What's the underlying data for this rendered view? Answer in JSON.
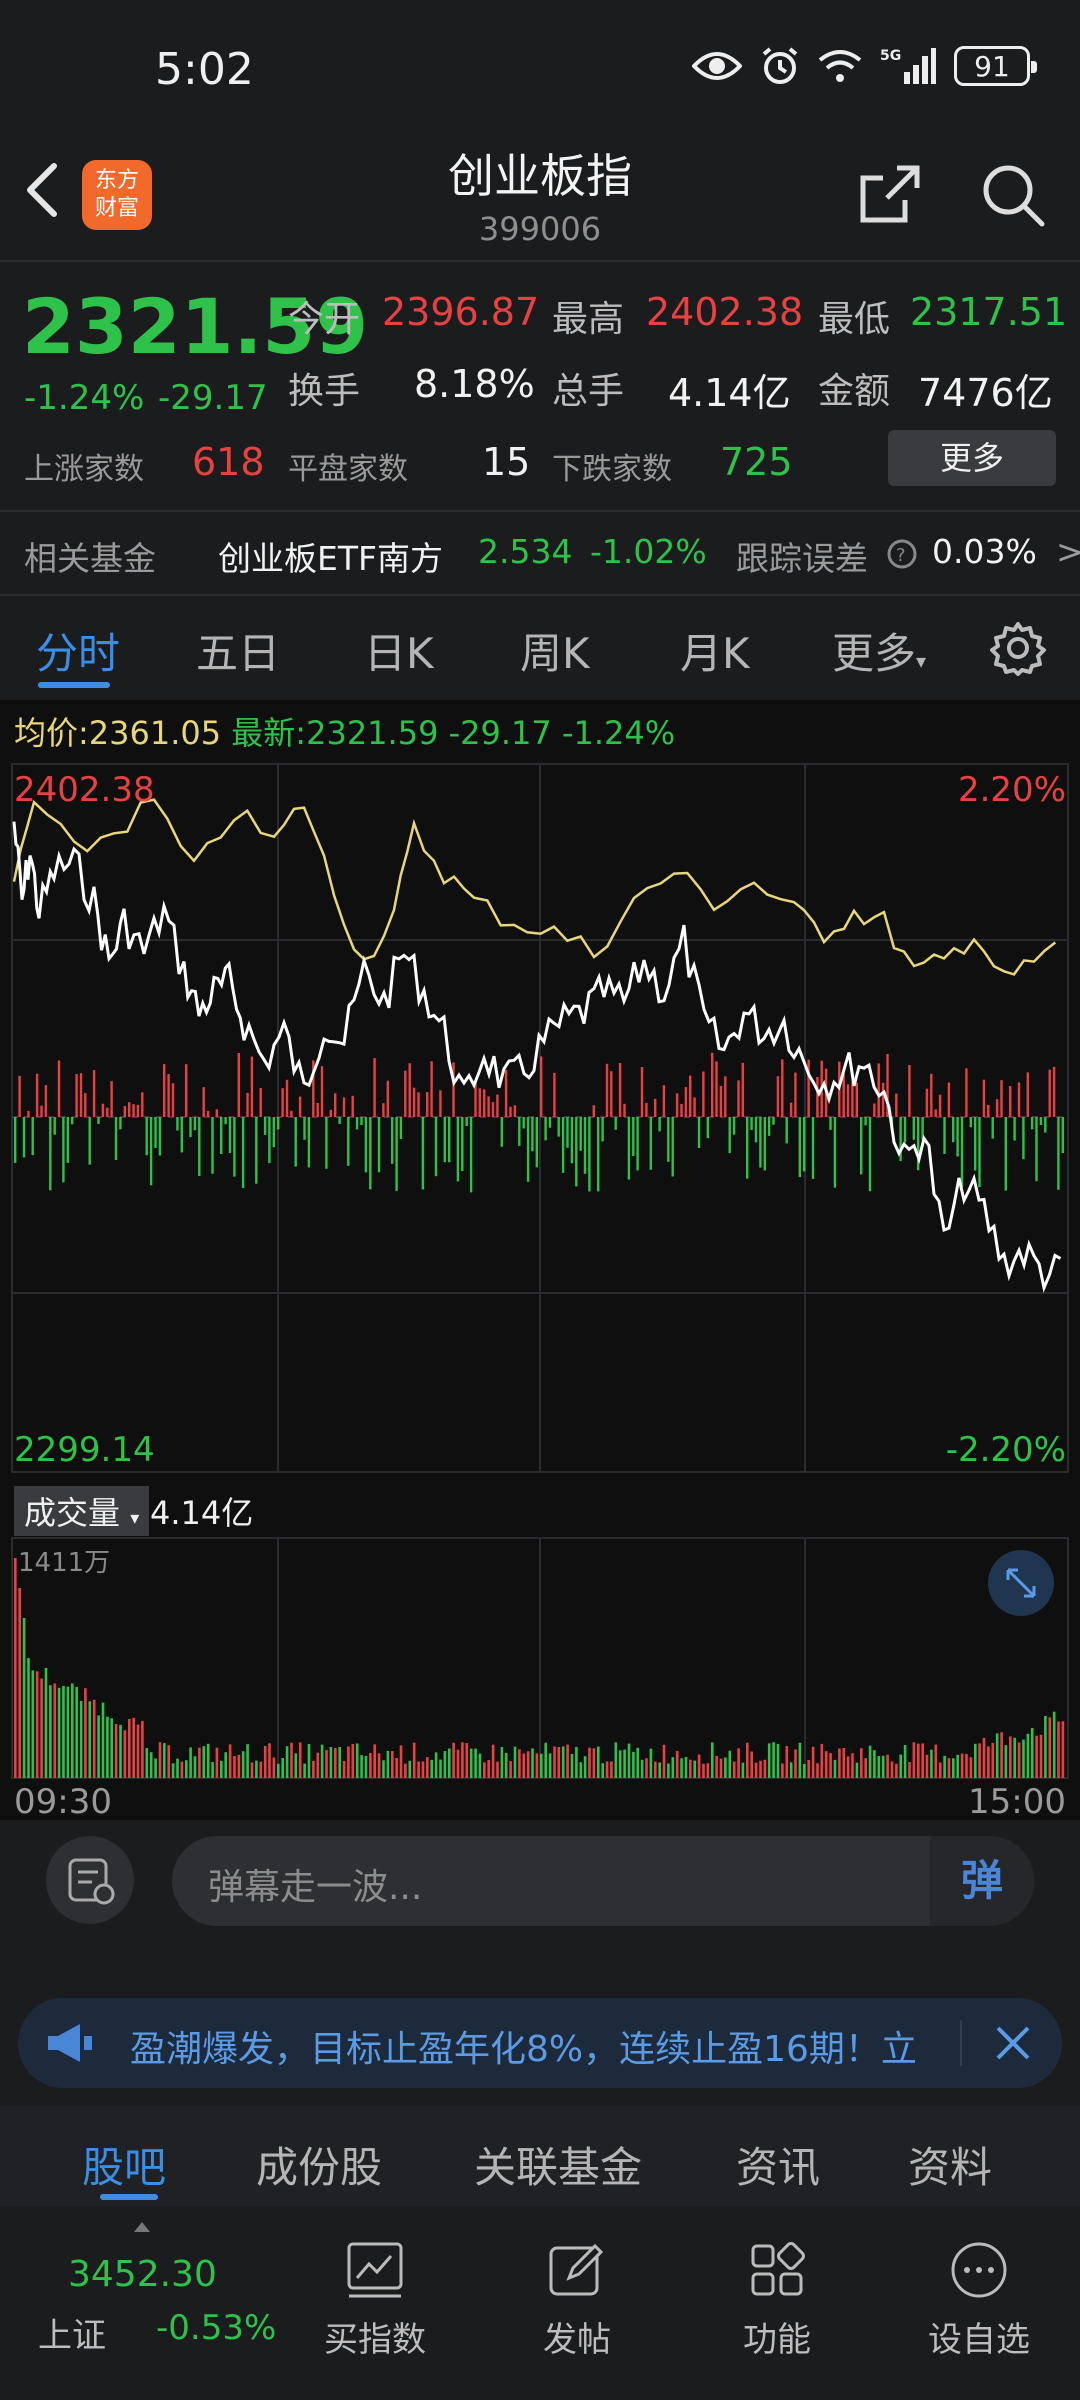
{
  "status_bar": {
    "time": "5:02",
    "battery": "91",
    "network": "5G"
  },
  "header": {
    "title": "创业板指",
    "code": "399006",
    "logo_text": "东方财富"
  },
  "quote": {
    "price": "2321.59",
    "change_pct": "-1.24%",
    "change_val": "-29.17",
    "open_label": "今开",
    "open": "2396.87",
    "high_label": "最高",
    "high": "2402.38",
    "low_label": "最低",
    "low": "2317.51",
    "turnover_label": "换手",
    "turnover": "8.18%",
    "volume_label": "总手",
    "volume": "4.14亿",
    "amount_label": "金额",
    "amount": "7476亿",
    "up_label": "上涨家数",
    "up": "618",
    "flat_label": "平盘家数",
    "flat": "15",
    "down_label": "下跌家数",
    "down": "725",
    "more": "更多"
  },
  "fund": {
    "label": "相关基金",
    "name": "创业板ETF南方",
    "price": "2.534",
    "pct": "-1.02%",
    "track_label": "跟踪误差",
    "track_val": "0.03%",
    "arrow": ">"
  },
  "tabs": [
    "分时",
    "五日",
    "日K",
    "周K",
    "月K",
    "更多"
  ],
  "chart": {
    "avg_label": "均价:",
    "avg_value": "2361.05",
    "latest_label": "最新:",
    "latest_value": "2321.59",
    "latest_change": "-29.17",
    "latest_pct": "-1.24%",
    "top_price": "2402.38",
    "top_pct": "2.20%",
    "bottom_price": "2299.14",
    "bottom_pct": "-2.20%",
    "volume_label": "成交量",
    "volume_total": "4.14亿",
    "volume_max": "1411万",
    "time_start": "09:30",
    "time_end": "15:00"
  },
  "danmu": {
    "placeholder": "弹幕走一波...",
    "button": "弹"
  },
  "banner": {
    "text": "盈潮爆发，目标止盈年化8%，连续止盈16期！立"
  },
  "subtabs": [
    "股吧",
    "成份股",
    "关联基金",
    "资讯",
    "资料"
  ],
  "bottom": {
    "index_value": "3452.30",
    "index_name": "上证",
    "index_pct": "-0.53%",
    "items": [
      "买指数",
      "发帖",
      "功能",
      "设自选"
    ]
  },
  "colors": {
    "up": "#e84142",
    "down": "#2ec24a",
    "accent": "#3a8ee6",
    "avg_line": "#e8d77a"
  }
}
